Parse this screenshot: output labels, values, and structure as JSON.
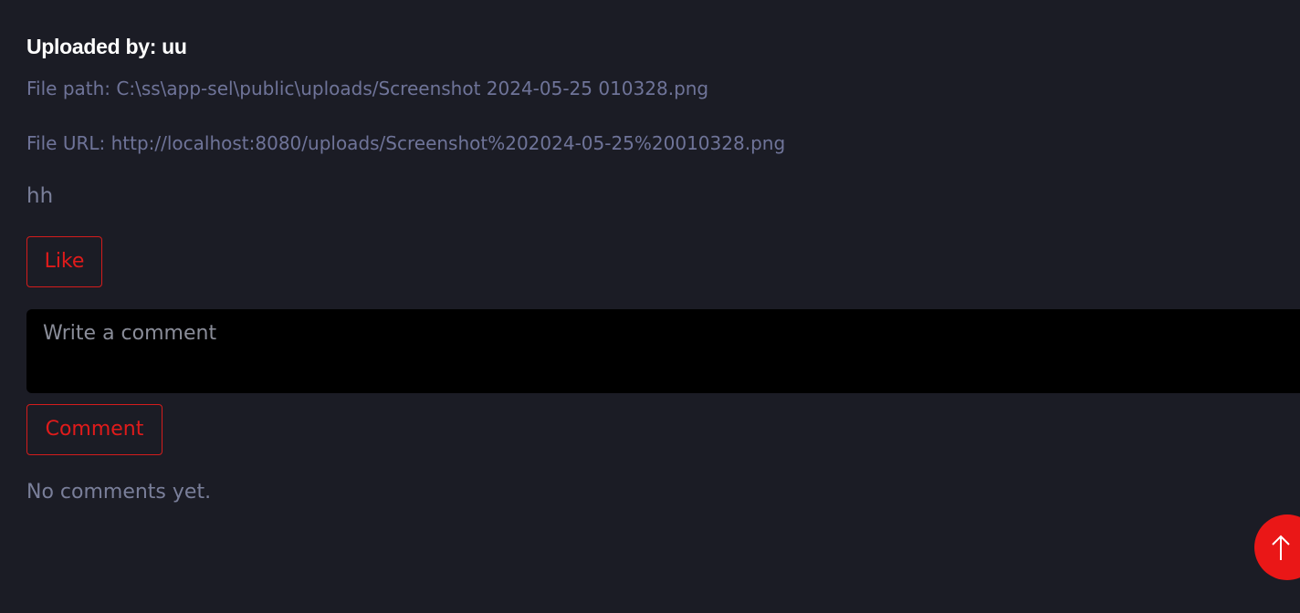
{
  "post": {
    "uploaded_by": "Uploaded by: uu",
    "file_path": "File path: C:\\ss\\app-sel\\public\\uploads/Screenshot 2024-05-25 010328.png",
    "file_url": "File URL: http://localhost:8080/uploads/Screenshot%202024-05-25%20010328.png",
    "description": "hh"
  },
  "actions": {
    "like_label": "Like",
    "comment_label": "Comment"
  },
  "comment_input": {
    "placeholder": "Write a comment",
    "value": ""
  },
  "comments": {
    "empty_text": "No comments yet."
  },
  "scroll_top": {
    "icon": "arrow-up-icon"
  },
  "colors": {
    "background": "#1b1c25",
    "accent": "#e01b1b",
    "muted_text": "#6f7499",
    "input_bg": "#000000"
  }
}
